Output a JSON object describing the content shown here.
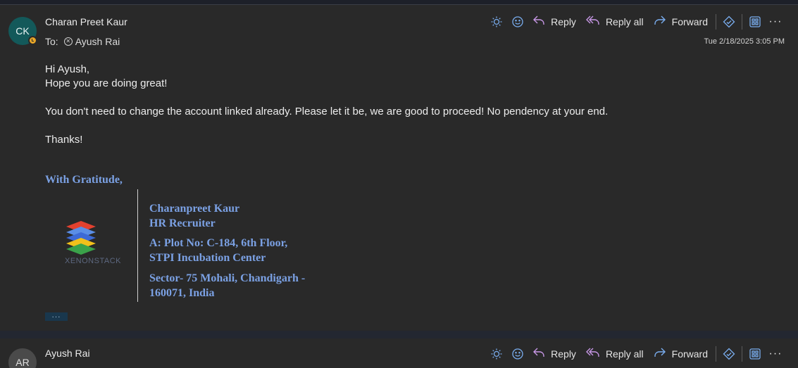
{
  "message1": {
    "avatar_initials": "CK",
    "sender": "Charan Preet Kaur",
    "to_label": "To:",
    "recipient": "Ayush Rai",
    "timestamp": "Tue 2/18/2025 3:05 PM",
    "body": {
      "greeting": "Hi Ayush,",
      "line2": "Hope you are doing great!",
      "para2": "You don't need to change the account linked already. Please let it be, we are good to proceed! No pendency at your end.",
      "thanks": "Thanks!"
    },
    "signature": {
      "closing": "With Gratitude,",
      "logo_text": "XENONSTACK",
      "name": "Charanpreet Kaur",
      "title": "HR Recruiter",
      "address_line1": "A: Plot No: C-184, 6th Floor,",
      "address_line2": "STPI Incubation Center",
      "address_line3": "Sector- 75 Mohali, Chandigarh -",
      "address_line4": "160071, India"
    },
    "expand_label": "···"
  },
  "message2": {
    "avatar_initials": "AR",
    "sender": "Ayush Rai"
  },
  "toolbar": {
    "reply_label": "Reply",
    "reply_all_label": "Reply all",
    "forward_label": "Forward",
    "more_label": "···",
    "icons": [
      "sun-icon",
      "emoji-icon",
      "reply-icon",
      "reply-all-icon",
      "forward-icon",
      "copilot-icon",
      "apps-icon",
      "more-icon"
    ]
  },
  "colors": {
    "background": "#292929",
    "accent_blue": "#7aaef0",
    "reply_purple": "#c797e6",
    "signature_blue": "#7ba1e4",
    "avatar_ck": "#13595a",
    "presence_away": "#e8a628"
  }
}
